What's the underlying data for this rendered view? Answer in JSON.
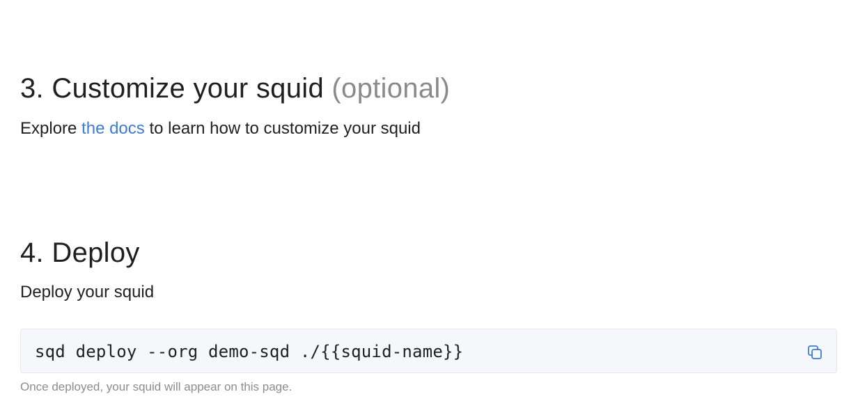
{
  "customize": {
    "number": "3.",
    "title": "Customize your squid",
    "optional_label": "(optional)",
    "desc_prefix": "Explore",
    "docs_link": "the docs",
    "desc_suffix": "to learn how to customize your squid"
  },
  "deploy": {
    "number": "4.",
    "title": "Deploy",
    "desc": "Deploy your squid",
    "command": "sqd deploy --org demo-sqd ./{{squid-name}}",
    "copy_icon": "copy-icon",
    "hint": "Once deployed, your squid will appear on this page."
  },
  "colors": {
    "link": "#3e7bd6",
    "copy_icon": "#3e7bd6",
    "muted": "#8a8a8a",
    "code_bg": "#f5f7fb"
  }
}
